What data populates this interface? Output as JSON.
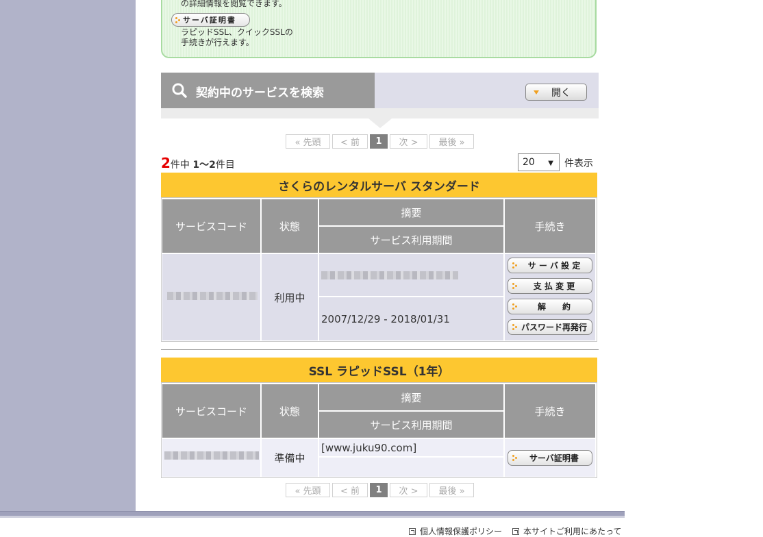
{
  "info_box": {
    "top_text": "の詳細情報を閲覧できます。",
    "cert_button_label": "サーバ証明書",
    "desc_line1": "ラピッドSSL、クイックSSLの",
    "desc_line2": "手続きが行えます。"
  },
  "search": {
    "title": "契約中のサービスを検索",
    "open_label": "開く"
  },
  "pager": {
    "first": "« 先頭",
    "prev": "< 前",
    "current": "1",
    "next": "次 >",
    "last": "最後 »"
  },
  "results": {
    "total": "2",
    "suffix1": "件中",
    "range": "1～2",
    "suffix2": "件目",
    "per_page": "20",
    "per_page_label": "件表示"
  },
  "columns": {
    "code": "サービスコード",
    "status": "状態",
    "summary": "摘要",
    "period": "サービス利用期間",
    "procedure": "手続き"
  },
  "services": [
    {
      "name": "さくらのレンタルサーバ スタンダード",
      "status": "利用中",
      "period": "2007/12/29 - 2018/01/31",
      "actions": [
        "サ ー バ 設 定",
        "支 払 変 更",
        "解　　約",
        "パスワード再発行"
      ]
    },
    {
      "name": "SSL ラピッドSSL（1年）",
      "status": "準備中",
      "summary": "[www.juku90.com]",
      "actions": [
        "サーバ証明書"
      ]
    }
  ],
  "footer": {
    "privacy": "個人情報保護ポリシー",
    "terms": "本サイトご利用にあたって"
  },
  "colors": {
    "section_header": "#fdc730",
    "table_header": "#9a9a9a",
    "total_count": "#e60000"
  },
  "icons": [
    "search-icon",
    "dot-icon",
    "triangle-down-icon",
    "external-link-icon"
  ]
}
